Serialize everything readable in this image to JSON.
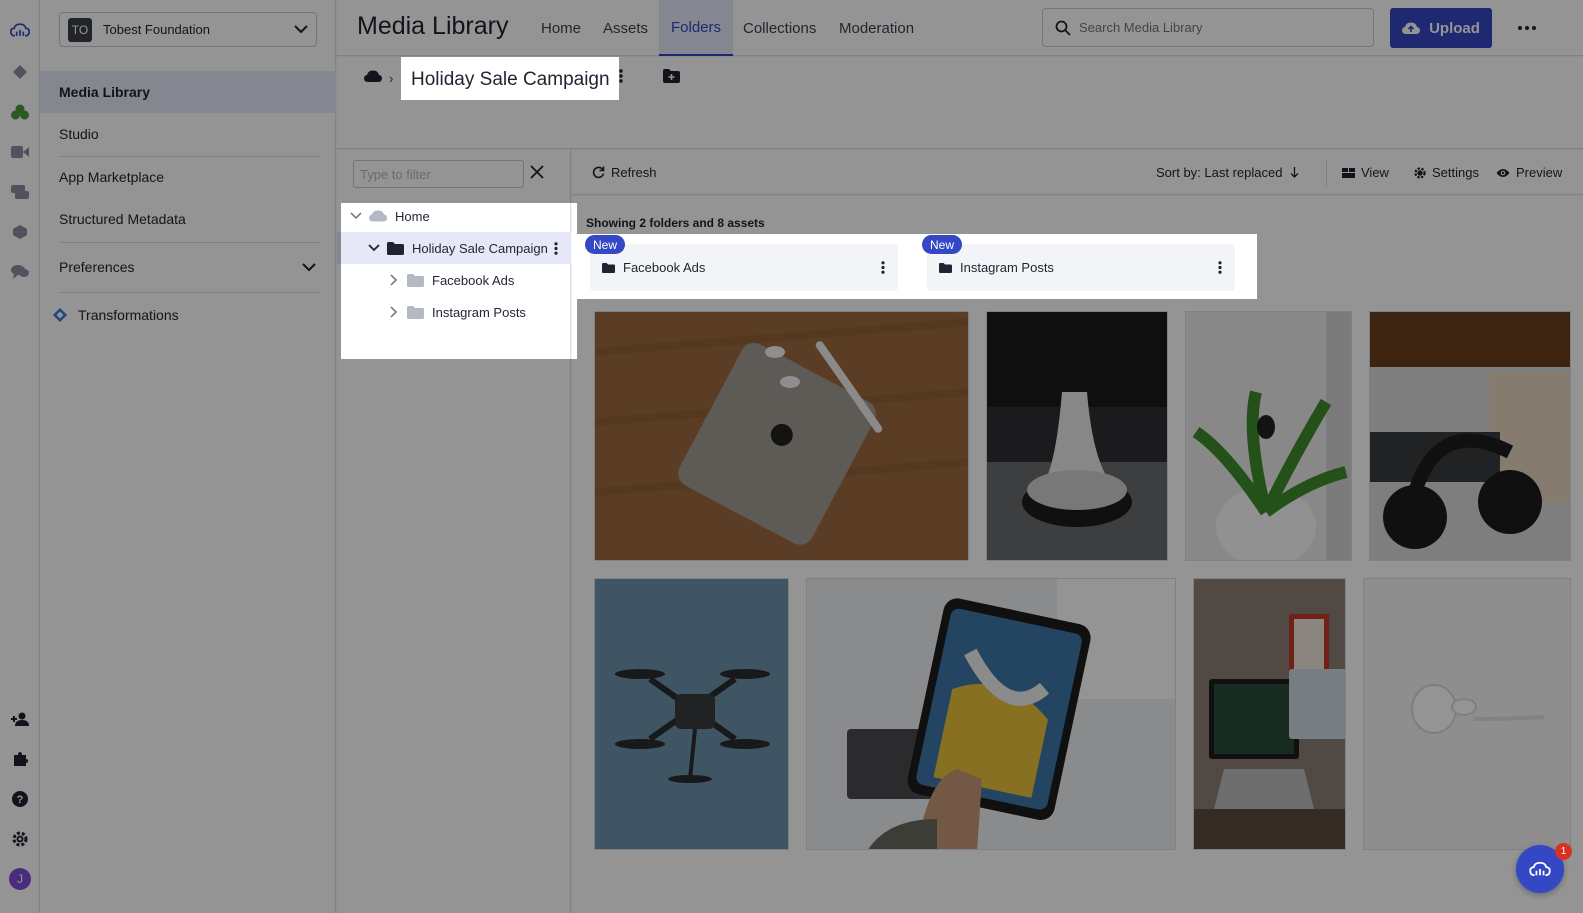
{
  "org": {
    "initials": "TO",
    "name": "Tobest Foundation"
  },
  "nav": {
    "items": [
      {
        "label": "Media Library"
      },
      {
        "label": "Studio"
      },
      {
        "label": "App Marketplace"
      },
      {
        "label": "Structured Metadata"
      },
      {
        "label": "Preferences"
      },
      {
        "label": "Transformations"
      }
    ]
  },
  "header": {
    "title": "Media Library",
    "tabs": [
      {
        "label": "Home"
      },
      {
        "label": "Assets"
      },
      {
        "label": "Folders"
      },
      {
        "label": "Collections"
      },
      {
        "label": "Moderation"
      }
    ],
    "active_tab": "Folders",
    "search_placeholder": "Search Media Library",
    "upload_label": "Upload"
  },
  "breadcrumb": {
    "current": "Holiday Sale Campaign",
    "separator": "›"
  },
  "tree": {
    "filter_placeholder": "Type to filter",
    "rows": [
      {
        "label": "Home"
      },
      {
        "label": "Holiday Sale Campaign"
      },
      {
        "label": "Facebook Ads"
      },
      {
        "label": "Instagram Posts"
      }
    ]
  },
  "toolbar": {
    "refresh": "Refresh",
    "sort": "Sort by: Last replaced",
    "view": "View",
    "settings": "Settings",
    "preview": "Preview"
  },
  "content": {
    "showing": "Showing 2 folders and 8 assets",
    "folders": [
      {
        "name": "Facebook Ads",
        "badge": "New"
      },
      {
        "name": "Instagram Posts",
        "badge": "New"
      }
    ],
    "asset_count": 8
  },
  "user": {
    "initial": "J"
  },
  "chat": {
    "count": "1"
  },
  "colors": {
    "accent": "#3448c5",
    "overlay": "rgba(0,0,0,0.42)"
  }
}
